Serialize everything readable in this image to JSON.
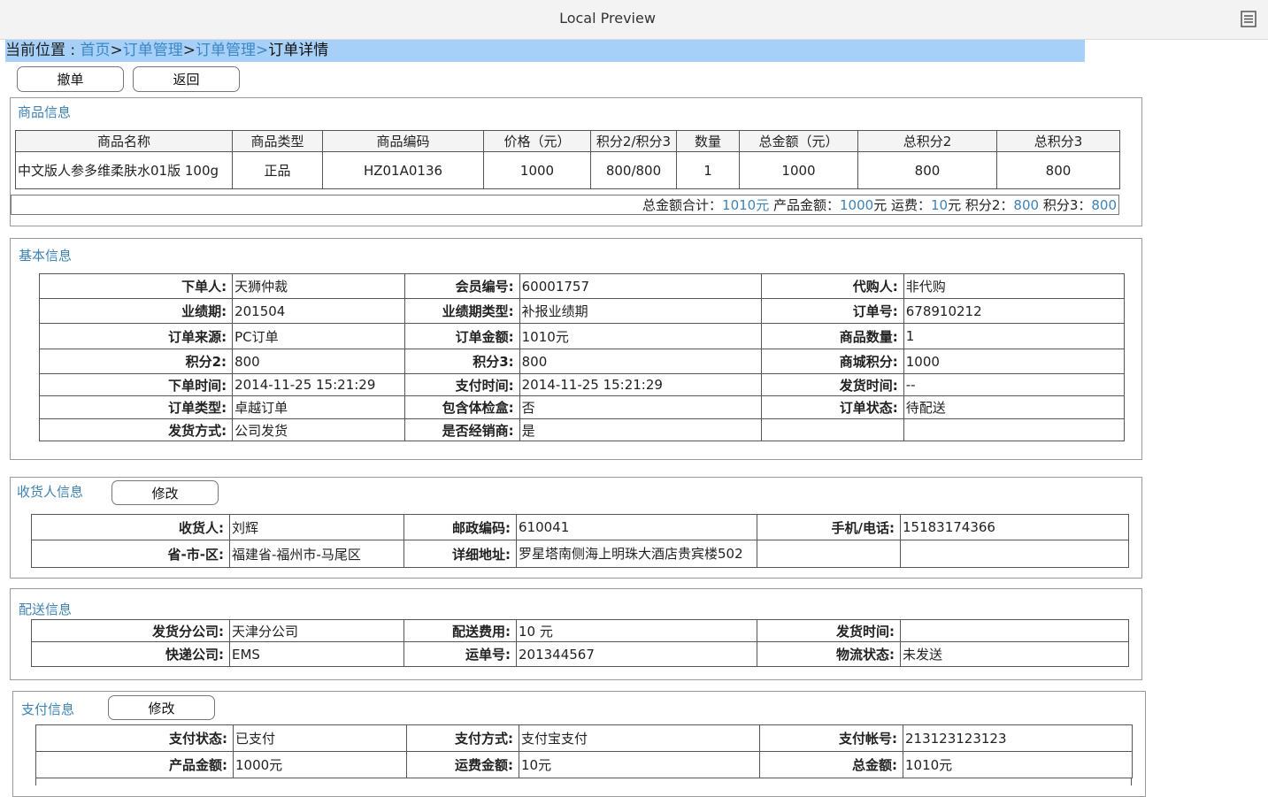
{
  "window": {
    "title": "Local Preview",
    "menu_icon": "list-menu-icon"
  },
  "breadcrumb": {
    "prefix": "当前位置 : ",
    "items": [
      "首页",
      "订单管理",
      "订单管理"
    ],
    "separator": ">",
    "current": "订单详情"
  },
  "actions": {
    "revoke": "撤单",
    "back": "返回"
  },
  "product_section": {
    "title": "商品信息",
    "columns": [
      "商品名称",
      "商品类型",
      "商品编码",
      "价格（元）",
      "积分2/积分3",
      "数量",
      "总金额（元）",
      "总积分2",
      "总积分3"
    ],
    "rows": [
      [
        "中文版人参多维柔肤水01版 100g",
        "正品",
        "HZ01A0136",
        "1000",
        "800/800",
        "1",
        "1000",
        "800",
        "800"
      ]
    ],
    "summary": {
      "total_label": "总金额合计：",
      "total_value": "1010元",
      "product_label": " 产品金额：",
      "product_value": "1000",
      "product_unit": "元",
      "shipping_label": " 运费：",
      "shipping_value": "10",
      "shipping_unit": "元",
      "p2_label": " 积分2：",
      "p2_value": "800",
      "p3_label": " 积分3：",
      "p3_value": "800"
    }
  },
  "basic_section": {
    "title": "基本信息",
    "rows": [
      [
        "下单人:",
        "天狮仲裁",
        "会员编号:",
        "60001757",
        "代购人:",
        "非代购"
      ],
      [
        "业绩期:",
        "201504",
        "业绩期类型:",
        "补报业绩期",
        "订单号:",
        "678910212"
      ],
      [
        "订单来源:",
        "PC订单",
        "订单金额:",
        "1010元",
        "商品数量:",
        "1"
      ],
      [
        "积分2:",
        "800",
        "积分3:",
        "800",
        "商城积分:",
        "1000"
      ],
      [
        "下单时间:",
        "  2014-11-25 15:21:29",
        "支付时间:",
        "2014-11-25 15:21:29",
        "发货时间:",
        "--"
      ],
      [
        "订单类型:",
        "卓越订单",
        "包含体检盒:",
        "否",
        "订单状态:",
        "待配送"
      ],
      [
        "发货方式:",
        "公司发货",
        "是否经销商:",
        "是",
        "",
        ""
      ]
    ]
  },
  "receiver_section": {
    "title": "收货人信息",
    "edit": "修改",
    "rows": [
      [
        "收货人:",
        "刘辉",
        "邮政编码:",
        "610041",
        "手机/电话:",
        "15183174366"
      ],
      [
        "省-市-区:",
        "福建省-福州市-马尾区",
        "详细地址:",
        "罗星塔南侧海上明珠大酒店贵宾楼502",
        "",
        ""
      ]
    ]
  },
  "delivery_section": {
    "title": "配送信息",
    "rows": [
      [
        "发货分公司:",
        "天津分公司",
        "配送费用:",
        "10 元",
        "发货时间:",
        ""
      ],
      [
        "快递公司:",
        "EMS",
        "运单号:",
        "201344567",
        "物流状态:",
        "未发送"
      ]
    ]
  },
  "payment_section": {
    "title": "支付信息",
    "edit": "修改",
    "rows": [
      [
        "支付状态:",
        "已支付",
        "支付方式:",
        "支付宝支付",
        "支付帐号:",
        "213123123123"
      ],
      [
        "产品金额:",
        "1000元",
        "运费金额:",
        "10元",
        "总金额:",
        "1010元"
      ]
    ]
  }
}
